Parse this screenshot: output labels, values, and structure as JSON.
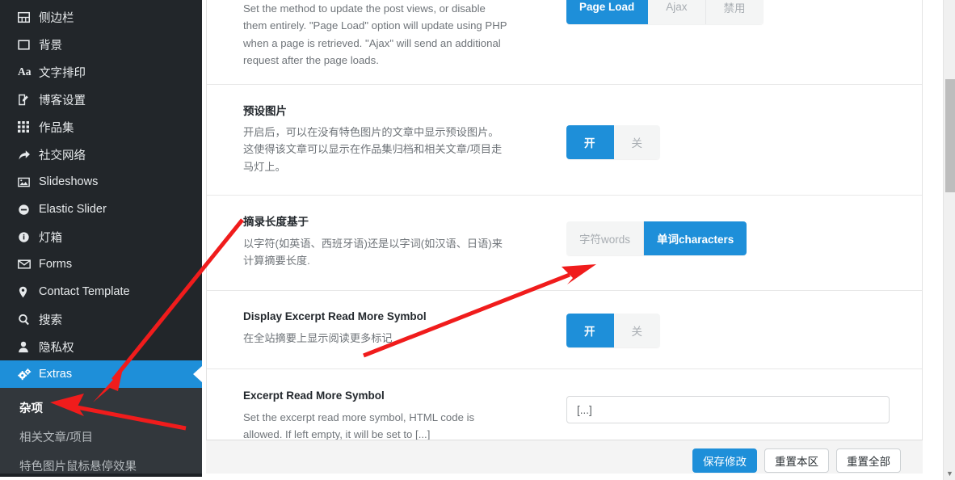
{
  "sidebar": {
    "items": [
      {
        "label": "侧边栏",
        "icon": "sidebar-layout-icon"
      },
      {
        "label": "背景",
        "icon": "background-square-icon"
      },
      {
        "label": "文字排印",
        "icon": "typography-aa-icon"
      },
      {
        "label": "博客设置",
        "icon": "edit-pencil-icon"
      },
      {
        "label": "作品集",
        "icon": "grid-portfolio-icon"
      },
      {
        "label": "社交网络",
        "icon": "share-arrow-icon"
      },
      {
        "label": "Slideshows",
        "icon": "image-picture-icon"
      },
      {
        "label": "Elastic Slider",
        "icon": "minus-circle-icon"
      },
      {
        "label": "灯箱",
        "icon": "info-circle-icon"
      },
      {
        "label": "Forms",
        "icon": "envelope-icon"
      },
      {
        "label": "Contact Template",
        "icon": "map-pin-icon"
      },
      {
        "label": "搜索",
        "icon": "search-icon"
      },
      {
        "label": "隐私权",
        "icon": "user-icon"
      },
      {
        "label": "Extras",
        "icon": "gears-icon",
        "active": true
      }
    ],
    "submenu": [
      {
        "label": "杂项",
        "current": true
      },
      {
        "label": "相关文章/项目",
        "current": false
      },
      {
        "label": "特色图片鼠标悬停效果",
        "current": false
      }
    ]
  },
  "sections": [
    {
      "name": "post-views-method",
      "title": "",
      "desc": "Set the method to update the post views, or disable them entirely. \"Page Load\" option will update using PHP when a page is retrieved. \"Ajax\" will send an additional request after the page loads.",
      "control": "button-group",
      "options": [
        {
          "label": "Page Load",
          "active": true
        },
        {
          "label": "Ajax",
          "active": false
        },
        {
          "label": "禁用",
          "active": false
        }
      ]
    },
    {
      "name": "preset-image",
      "title": "预设图片",
      "desc": "开启后，可以在没有特色图片的文章中显示预设图片。这使得该文章可以显示在作品集归档和相关文章/项目走马灯上。",
      "control": "button-group",
      "options": [
        {
          "label": "开",
          "active": true
        },
        {
          "label": "关",
          "active": false
        }
      ]
    },
    {
      "name": "excerpt-length-basis",
      "title": "摘录长度基于",
      "desc": "以字符(如英语、西班牙语)还是以字词(如汉语、日语)来计算摘要长度.",
      "control": "button-group",
      "options": [
        {
          "label": "字符words",
          "active": false
        },
        {
          "label": "单词characters",
          "active": true
        }
      ]
    },
    {
      "name": "display-excerpt-read-more-symbol",
      "title": "Display Excerpt Read More Symbol",
      "desc": "在全站摘要上显示阅读更多标记",
      "control": "button-group",
      "options": [
        {
          "label": "开",
          "active": true
        },
        {
          "label": "关",
          "active": false
        }
      ]
    },
    {
      "name": "excerpt-read-more-symbol",
      "title": "Excerpt Read More Symbol",
      "desc": "Set the excerpt read more symbol, HTML code is allowed. If left empty, it will be set to [...]",
      "control": "text-input",
      "value": "[...]"
    }
  ],
  "footer": {
    "save_label": "保存修改",
    "reset_section_label": "重置本区",
    "reset_all_label": "重置全部"
  },
  "colors": {
    "accent": "#1e8fd9",
    "sidebar_bg": "#22262a",
    "submenu_bg": "#32373c",
    "annotation": "#f01c1c"
  }
}
